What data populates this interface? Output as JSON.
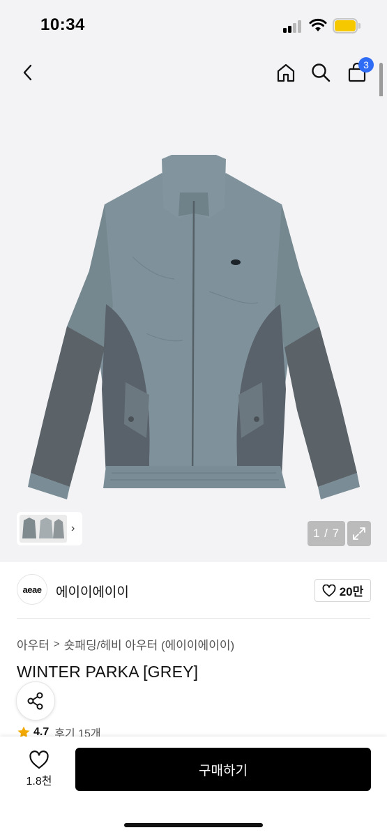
{
  "status_bar": {
    "time": "10:34",
    "signal_icon": "cellular-signal-icon",
    "wifi_icon": "wifi-icon",
    "battery_icon": "battery-icon",
    "battery_color": "#f5c800"
  },
  "nav": {
    "back_icon": "chevron-left-icon",
    "home_icon": "home-icon",
    "search_icon": "search-icon",
    "cart_icon": "shopping-bag-icon",
    "cart_badge": "3",
    "badge_color": "#2f6cf5"
  },
  "gallery": {
    "image_icon": "jacket-product-image",
    "counter": "1 / 7",
    "expand_icon": "expand-icon",
    "thumb_arrow": "›"
  },
  "brand": {
    "logo_text": "aeae",
    "name": "에이이에이이",
    "like_icon": "heart-icon",
    "like_count": "20만"
  },
  "breadcrumb": {
    "category": "아우터",
    "separator": ">",
    "subcategory": "숏패딩/헤비 아우터 (에이이에이이)"
  },
  "product": {
    "title": "WINTER PARKA [GREY]",
    "share_icon": "share-icon",
    "rating": "4.7",
    "star_icon": "star-icon",
    "star_color": "#f2a900",
    "reviews": "후기 15개"
  },
  "bottom_bar": {
    "wish_icon": "heart-icon",
    "wish_count": "1.8천",
    "buy_label": "구매하기"
  }
}
